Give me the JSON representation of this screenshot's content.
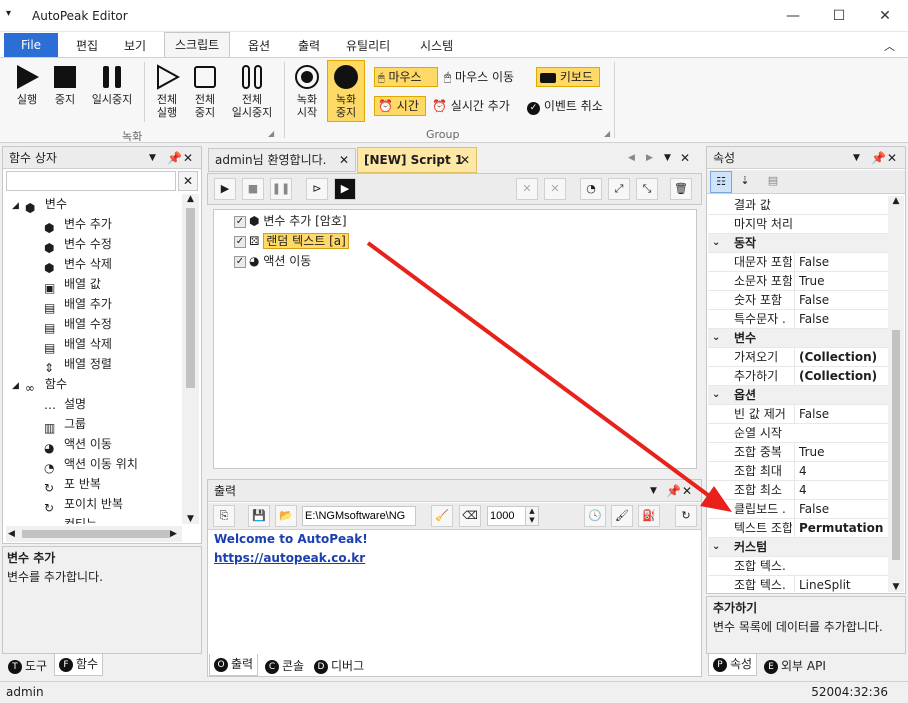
{
  "app": {
    "title": "AutoPeak Editor"
  },
  "window": {
    "min": "—",
    "max": "☐",
    "close": "✕"
  },
  "menu": {
    "file": "File",
    "items": [
      "편집",
      "보기",
      "스크립트",
      "옵션",
      "출력",
      "유틸리티",
      "시스템"
    ]
  },
  "ribbon": {
    "run": "실행",
    "stop": "중지",
    "pause": "일시중지",
    "all_run": "전체\n실행",
    "all_stop": "전체\n중지",
    "all_pause": "전체\n일시중지",
    "rec_start": "녹화\n시작",
    "rec_stop": "녹화\n중지",
    "opt_mouse": "마우스",
    "opt_mouse_move": "마우스 이동",
    "opt_keyboard": "키보드",
    "opt_time": "시간",
    "opt_realtime": "실시간 추가",
    "opt_cancel_event": "이벤트 취소",
    "group_rec": "녹화",
    "group_group": "Group"
  },
  "left_panel": {
    "title": "함수 상자",
    "search_placeholder": "",
    "tree": [
      {
        "label": "변수",
        "type": "category"
      },
      {
        "label": "변수 추가",
        "type": "item"
      },
      {
        "label": "변수 수정",
        "type": "item"
      },
      {
        "label": "변수 삭제",
        "type": "item"
      },
      {
        "label": "배열 값",
        "type": "item"
      },
      {
        "label": "배열 추가",
        "type": "item"
      },
      {
        "label": "배열 수정",
        "type": "item"
      },
      {
        "label": "배열 삭제",
        "type": "item"
      },
      {
        "label": "배열 정렬",
        "type": "item"
      },
      {
        "label": "함수",
        "type": "category"
      },
      {
        "label": "설명",
        "type": "item"
      },
      {
        "label": "그룹",
        "type": "item"
      },
      {
        "label": "액션 이동",
        "type": "item"
      },
      {
        "label": "액션 이동 위치",
        "type": "item"
      },
      {
        "label": "포 반복",
        "type": "item"
      },
      {
        "label": "포이치 반복",
        "type": "item"
      },
      {
        "label": "컨티뉴",
        "type": "item"
      }
    ],
    "desc_title": "변수 추가",
    "desc_text": "변수를 추가합니다.",
    "tabs": [
      {
        "badge": "T",
        "label": "도구"
      },
      {
        "badge": "F",
        "label": "함수"
      }
    ]
  },
  "editor": {
    "tabs": [
      {
        "label": "admin님 환영합니다."
      },
      {
        "label": "[NEW] Script 1"
      }
    ],
    "lines": [
      {
        "label": "변수 추가 [암호]",
        "checked": true
      },
      {
        "label": "랜덤 텍스트 [a]",
        "checked": true
      },
      {
        "label": "액션 이동",
        "checked": true
      }
    ]
  },
  "output": {
    "title": "출력",
    "path": "E:\\NGMsoftware\\NG",
    "interval": "1000",
    "welcome": "Welcome to AutoPeak!",
    "link": "https://autopeak.co.kr",
    "tabs": [
      {
        "badge": "O",
        "label": "출력"
      },
      {
        "badge": "C",
        "label": "콘솔"
      },
      {
        "badge": "D",
        "label": "디버그"
      }
    ]
  },
  "properties": {
    "title": "속성",
    "rows": [
      {
        "kind": "row",
        "name": "결과 값",
        "value": ""
      },
      {
        "kind": "row",
        "name": "마지막 처리",
        "value": ""
      },
      {
        "kind": "cat",
        "name": "동작"
      },
      {
        "kind": "row",
        "name": "대문자 포함",
        "value": "False"
      },
      {
        "kind": "row",
        "name": "소문자 포함",
        "value": "True"
      },
      {
        "kind": "row",
        "name": "숫자 포함",
        "value": "False"
      },
      {
        "kind": "row",
        "name": "특수문자 .",
        "value": "False"
      },
      {
        "kind": "cat",
        "name": "변수"
      },
      {
        "kind": "row",
        "name": "가져오기",
        "value": "(Collection)",
        "bold": true
      },
      {
        "kind": "row",
        "name": "추가하기",
        "value": "(Collection)",
        "bold": true
      },
      {
        "kind": "cat",
        "name": "옵션"
      },
      {
        "kind": "row",
        "name": "빈 값 제거",
        "value": "False"
      },
      {
        "kind": "row",
        "name": "순열 시작",
        "value": ""
      },
      {
        "kind": "row",
        "name": "조합 중복",
        "value": "True"
      },
      {
        "kind": "row",
        "name": "조합 최대",
        "value": "4"
      },
      {
        "kind": "row",
        "name": "조합 최소",
        "value": "4"
      },
      {
        "kind": "row",
        "name": "클립보드 .",
        "value": "False"
      },
      {
        "kind": "row",
        "name": "텍스트 조합",
        "value": "Permutation",
        "bold": true
      },
      {
        "kind": "cat",
        "name": "커스텀"
      },
      {
        "kind": "row",
        "name": "조합 텍스.",
        "value": ""
      },
      {
        "kind": "row",
        "name": "조합 텍스.",
        "value": "LineSplit"
      }
    ],
    "desc_title": "추가하기",
    "desc_text": "변수 목록에 데이터를 추가합니다.",
    "tabs": [
      {
        "badge": "P",
        "label": "속성"
      },
      {
        "badge": "E",
        "label": "외부 API"
      }
    ]
  },
  "status": {
    "user": "admin",
    "time": "52004:32:36"
  },
  "colors": {
    "accent": "#2b6fd6",
    "highlight": "#ffd966",
    "arrow": "#e8221b",
    "link": "#1a3fb0"
  }
}
